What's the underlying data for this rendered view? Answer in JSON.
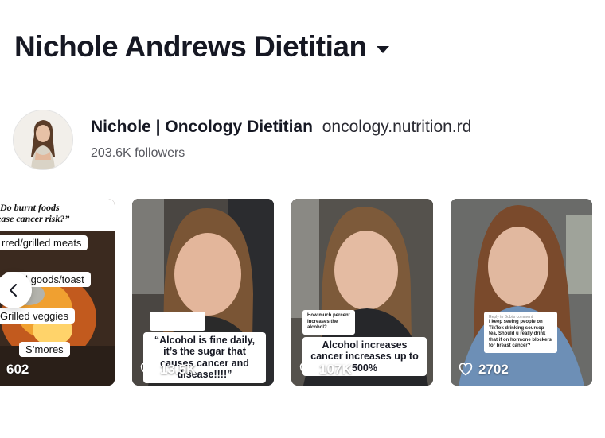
{
  "header": {
    "title": "Nichole Andrews Dietitian"
  },
  "profile": {
    "name": "Nichole | Oncology Dietitian",
    "handle": "oncology.nutrition.rd",
    "followers": "203.6K followers"
  },
  "videos": [
    {
      "views": "602",
      "headline": "Do burnt foods increase cancer risk?",
      "headline_line1": "Do burnt foods",
      "headline_line2": "ease cancer risk?”",
      "items": [
        "rred/grilled meats",
        "ked goods/toast",
        "Grilled  veggies",
        "S’mores"
      ]
    },
    {
      "views": "13.5K",
      "caption": "“Alcohol is fine daily, it’s the sugar that causes cancer and disease!!!!”"
    },
    {
      "views": "107K",
      "caption": "Alcohol increases cancer increases up to 500%",
      "reply_question": "How much percent increases the alcohol?"
    },
    {
      "views": "2702",
      "reply_header": "Reply to Bobi's comment",
      "reply_text": "I keep seeing people on TikTok drinking soursop tea. Should u really drink that if on hormone blockers for breast cancer?"
    }
  ],
  "icons": {
    "views": "heart-outline-icon",
    "prev": "chevron-left-icon",
    "dropdown": "caret-down-icon"
  }
}
